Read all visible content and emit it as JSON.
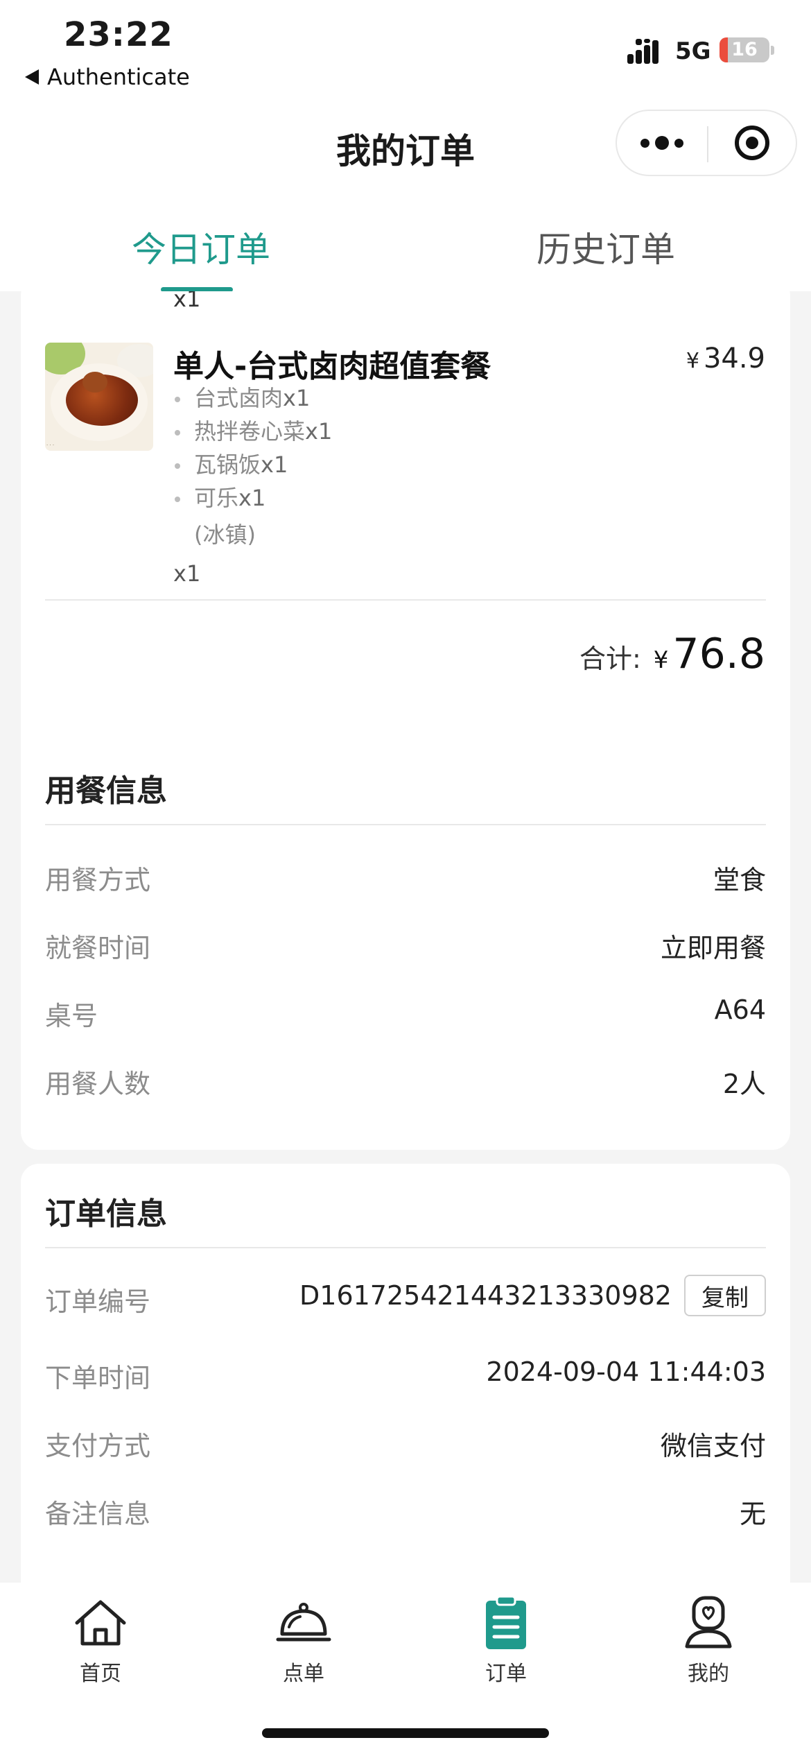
{
  "status_bar": {
    "time": "23:22",
    "back_app": "Authenticate",
    "network": "5G",
    "battery_level": "16",
    "battery_fraction": 0.16
  },
  "navbar": {
    "title": "我的订单",
    "more_icon": "more-dots-icon",
    "close_icon": "target-close-icon"
  },
  "tabs": {
    "today": "今日订单",
    "history": "历史订单",
    "active": "today"
  },
  "order_items": {
    "cut_off_qty": "x1",
    "item": {
      "name": "单人-台式卤肉超值套餐",
      "currency": "¥",
      "price": "34.9",
      "sub_items": [
        {
          "name": "台式卤肉",
          "qty": "x1"
        },
        {
          "name": "热拌卷心菜",
          "qty": "x1"
        },
        {
          "name": "瓦锅饭",
          "qty": "x1"
        },
        {
          "name": "可乐",
          "qty": "x1"
        }
      ],
      "sub_note": "(冰镇)",
      "qty": "x1"
    },
    "total_label": "合计:",
    "total_currency": "¥",
    "total_value": "76.8"
  },
  "dining_info": {
    "title": "用餐信息",
    "rows": [
      {
        "label": "用餐方式",
        "value": "堂食"
      },
      {
        "label": "就餐时间",
        "value": "立即用餐"
      },
      {
        "label": "桌号",
        "value": "A64"
      },
      {
        "label": "用餐人数",
        "value": "2人"
      }
    ]
  },
  "order_info": {
    "title": "订单信息",
    "order_no_label": "订单编号",
    "order_no": "D161725421443213330982",
    "copy_label": "复制",
    "rows": [
      {
        "label": "下单时间",
        "value": "2024-09-04 11:44:03"
      },
      {
        "label": "支付方式",
        "value": "微信支付"
      },
      {
        "label": "备注信息",
        "value": "无"
      }
    ]
  },
  "tabbar": {
    "items": [
      {
        "label": "首页",
        "icon": "home-icon"
      },
      {
        "label": "点单",
        "icon": "cloche-icon"
      },
      {
        "label": "订单",
        "icon": "clipboard-icon"
      },
      {
        "label": "我的",
        "icon": "profile-icon"
      }
    ],
    "active_index": 2,
    "accent": "#1f9a8c"
  }
}
